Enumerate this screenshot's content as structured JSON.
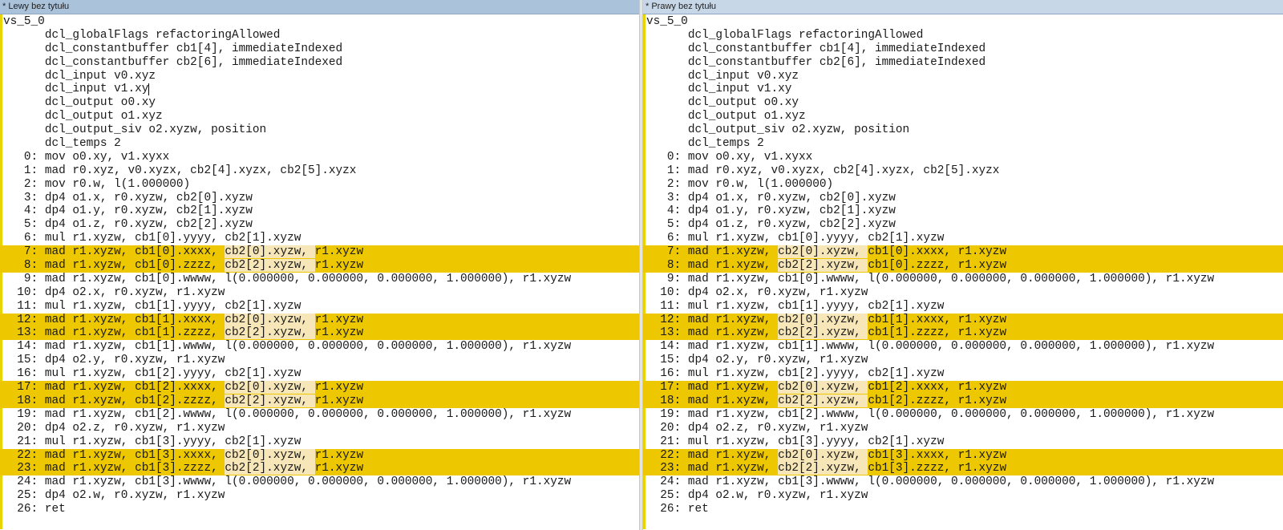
{
  "panes": {
    "left": {
      "title": "* Lewy bez tytułu"
    },
    "right": {
      "title": "* Prawy bez tytułu"
    }
  },
  "colors": {
    "highlight": "#edc700",
    "highlight_light": "#f6e6b8",
    "gutter": "#e8d400",
    "title_bar": "#aac2da"
  },
  "left_lines": [
    {
      "segs": [
        "vs_5_0"
      ]
    },
    {
      "segs": [
        "      dcl_globalFlags refactoringAllowed"
      ]
    },
    {
      "segs": [
        "      dcl_constantbuffer cb1[4], immediateIndexed"
      ]
    },
    {
      "segs": [
        "      dcl_constantbuffer cb2[6], immediateIndexed"
      ]
    },
    {
      "segs": [
        "      dcl_input v0.xyz"
      ]
    },
    {
      "segs": [
        "      dcl_input v1.xy"
      ]
    },
    {
      "segs": [
        "      dcl_output o0.xy"
      ]
    },
    {
      "segs": [
        "      dcl_output o1.xyz"
      ]
    },
    {
      "segs": [
        "      dcl_output_siv o2.xyzw, position"
      ]
    },
    {
      "segs": [
        "      dcl_temps 2"
      ]
    },
    {
      "segs": [
        "   0: mov o0.xy, v1.xyxx"
      ]
    },
    {
      "segs": [
        "   1: mad r0.xyz, v0.xyzx, cb2[4].xyzx, cb2[5].xyzx"
      ]
    },
    {
      "segs": [
        "   2: mov r0.w, l(1.000000)"
      ]
    },
    {
      "segs": [
        "   3: dp4 o1.x, r0.xyzw, cb2[0].xyzw"
      ]
    },
    {
      "segs": [
        "   4: dp4 o1.y, r0.xyzw, cb2[1].xyzw"
      ]
    },
    {
      "segs": [
        "   5: dp4 o1.z, r0.xyzw, cb2[2].xyzw"
      ]
    },
    {
      "segs": [
        "   6: mul r1.xyzw, cb1[0].yyyy, cb2[1].xyzw"
      ]
    },
    {
      "hl": true,
      "segs": [
        "   7: mad r1.xyzw, cb1[0].xxxx, ",
        "cb2[0].xyzw, ",
        "r1.xyzw"
      ]
    },
    {
      "hl": true,
      "segs": [
        "   8: mad r1.xyzw, cb1[0].zzzz, ",
        "cb2[2].xyzw, ",
        "r1.xyzw"
      ]
    },
    {
      "segs": [
        "   9: mad r1.xyzw, cb1[0].wwww, l(0.000000, 0.000000, 0.000000, 1.000000), r1.xyzw"
      ]
    },
    {
      "segs": [
        "  10: dp4 o2.x, r0.xyzw, r1.xyzw"
      ]
    },
    {
      "segs": [
        "  11: mul r1.xyzw, cb1[1].yyyy, cb2[1].xyzw"
      ]
    },
    {
      "hl": true,
      "segs": [
        "  12: mad r1.xyzw, cb1[1].xxxx, ",
        "cb2[0].xyzw, ",
        "r1.xyzw"
      ]
    },
    {
      "hl": true,
      "segs": [
        "  13: mad r1.xyzw, cb1[1].zzzz, ",
        "cb2[2].xyzw, ",
        "r1.xyzw"
      ]
    },
    {
      "segs": [
        "  14: mad r1.xyzw, cb1[1].wwww, l(0.000000, 0.000000, 0.000000, 1.000000), r1.xyzw"
      ]
    },
    {
      "segs": [
        "  15: dp4 o2.y, r0.xyzw, r1.xyzw"
      ]
    },
    {
      "segs": [
        "  16: mul r1.xyzw, cb1[2].yyyy, cb2[1].xyzw"
      ]
    },
    {
      "hl": true,
      "segs": [
        "  17: mad r1.xyzw, cb1[2].xxxx, ",
        "cb2[0].xyzw, ",
        "r1.xyzw"
      ]
    },
    {
      "hl": true,
      "segs": [
        "  18: mad r1.xyzw, cb1[2].zzzz, ",
        "cb2[2].xyzw, ",
        "r1.xyzw"
      ]
    },
    {
      "segs": [
        "  19: mad r1.xyzw, cb1[2].wwww, l(0.000000, 0.000000, 0.000000, 1.000000), r1.xyzw"
      ]
    },
    {
      "segs": [
        "  20: dp4 o2.z, r0.xyzw, r1.xyzw"
      ]
    },
    {
      "segs": [
        "  21: mul r1.xyzw, cb1[3].yyyy, cb2[1].xyzw"
      ]
    },
    {
      "hl": true,
      "segs": [
        "  22: mad r1.xyzw, cb1[3].xxxx, ",
        "cb2[0].xyzw, ",
        "r1.xyzw"
      ]
    },
    {
      "hl": true,
      "segs": [
        "  23: mad r1.xyzw, cb1[3].zzzz, ",
        "cb2[2].xyzw, ",
        "r1.xyzw"
      ]
    },
    {
      "segs": [
        "  24: mad r1.xyzw, cb1[3].wwww, l(0.000000, 0.000000, 0.000000, 1.000000), r1.xyzw"
      ]
    },
    {
      "segs": [
        "  25: dp4 o2.w, r0.xyzw, r1.xyzw"
      ]
    },
    {
      "segs": [
        "  26: ret"
      ]
    }
  ],
  "right_lines": [
    {
      "segs": [
        "vs_5_0"
      ]
    },
    {
      "segs": [
        "      dcl_globalFlags refactoringAllowed"
      ]
    },
    {
      "segs": [
        "      dcl_constantbuffer cb1[4], immediateIndexed"
      ]
    },
    {
      "segs": [
        "      dcl_constantbuffer cb2[6], immediateIndexed"
      ]
    },
    {
      "segs": [
        "      dcl_input v0.xyz"
      ]
    },
    {
      "segs": [
        "      dcl_input v1.xy"
      ]
    },
    {
      "segs": [
        "      dcl_output o0.xy"
      ]
    },
    {
      "segs": [
        "      dcl_output o1.xyz"
      ]
    },
    {
      "segs": [
        "      dcl_output_siv o2.xyzw, position"
      ]
    },
    {
      "segs": [
        "      dcl_temps 2"
      ]
    },
    {
      "segs": [
        "   0: mov o0.xy, v1.xyxx"
      ]
    },
    {
      "segs": [
        "   1: mad r0.xyz, v0.xyzx, cb2[4].xyzx, cb2[5].xyzx"
      ]
    },
    {
      "segs": [
        "   2: mov r0.w, l(1.000000)"
      ]
    },
    {
      "segs": [
        "   3: dp4 o1.x, r0.xyzw, cb2[0].xyzw"
      ]
    },
    {
      "segs": [
        "   4: dp4 o1.y, r0.xyzw, cb2[1].xyzw"
      ]
    },
    {
      "segs": [
        "   5: dp4 o1.z, r0.xyzw, cb2[2].xyzw"
      ]
    },
    {
      "segs": [
        "   6: mul r1.xyzw, cb1[0].yyyy, cb2[1].xyzw"
      ]
    },
    {
      "hl": true,
      "segs": [
        "   7: mad r1.xyzw, ",
        "cb2[0].xyzw, ",
        "cb1[0].xxxx, r1.xyzw"
      ]
    },
    {
      "hl": true,
      "segs": [
        "   8: mad r1.xyzw, ",
        "cb2[2].xyzw, ",
        "cb1[0].zzzz, r1.xyzw"
      ]
    },
    {
      "segs": [
        "   9: mad r1.xyzw, cb1[0].wwww, l(0.000000, 0.000000, 0.000000, 1.000000), r1.xyzw"
      ]
    },
    {
      "segs": [
        "  10: dp4 o2.x, r0.xyzw, r1.xyzw"
      ]
    },
    {
      "segs": [
        "  11: mul r1.xyzw, cb1[1].yyyy, cb2[1].xyzw"
      ]
    },
    {
      "hl": true,
      "segs": [
        "  12: mad r1.xyzw, ",
        "cb2[0].xyzw, ",
        "cb1[1].xxxx, r1.xyzw"
      ]
    },
    {
      "hl": true,
      "segs": [
        "  13: mad r1.xyzw, ",
        "cb2[2].xyzw, ",
        "cb1[1].zzzz, r1.xyzw"
      ]
    },
    {
      "segs": [
        "  14: mad r1.xyzw, cb1[1].wwww, l(0.000000, 0.000000, 0.000000, 1.000000), r1.xyzw"
      ]
    },
    {
      "segs": [
        "  15: dp4 o2.y, r0.xyzw, r1.xyzw"
      ]
    },
    {
      "segs": [
        "  16: mul r1.xyzw, cb1[2].yyyy, cb2[1].xyzw"
      ]
    },
    {
      "hl": true,
      "segs": [
        "  17: mad r1.xyzw, ",
        "cb2[0].xyzw, ",
        "cb1[2].xxxx, r1.xyzw"
      ]
    },
    {
      "hl": true,
      "segs": [
        "  18: mad r1.xyzw, ",
        "cb2[2].xyzw, ",
        "cb1[2].zzzz, r1.xyzw"
      ]
    },
    {
      "segs": [
        "  19: mad r1.xyzw, cb1[2].wwww, l(0.000000, 0.000000, 0.000000, 1.000000), r1.xyzw"
      ]
    },
    {
      "segs": [
        "  20: dp4 o2.z, r0.xyzw, r1.xyzw"
      ]
    },
    {
      "segs": [
        "  21: mul r1.xyzw, cb1[3].yyyy, cb2[1].xyzw"
      ]
    },
    {
      "hl": true,
      "segs": [
        "  22: mad r1.xyzw, ",
        "cb2[0].xyzw, ",
        "cb1[3].xxxx, r1.xyzw"
      ]
    },
    {
      "hl": true,
      "segs": [
        "  23: mad r1.xyzw, ",
        "cb2[2].xyzw, ",
        "cb1[3].zzzz, r1.xyzw"
      ]
    },
    {
      "segs": [
        "  24: mad r1.xyzw, cb1[3].wwww, l(0.000000, 0.000000, 0.000000, 1.000000), r1.xyzw"
      ]
    },
    {
      "segs": [
        "  25: dp4 o2.w, r0.xyzw, r1.xyzw"
      ]
    },
    {
      "segs": [
        "  26: ret"
      ]
    }
  ]
}
